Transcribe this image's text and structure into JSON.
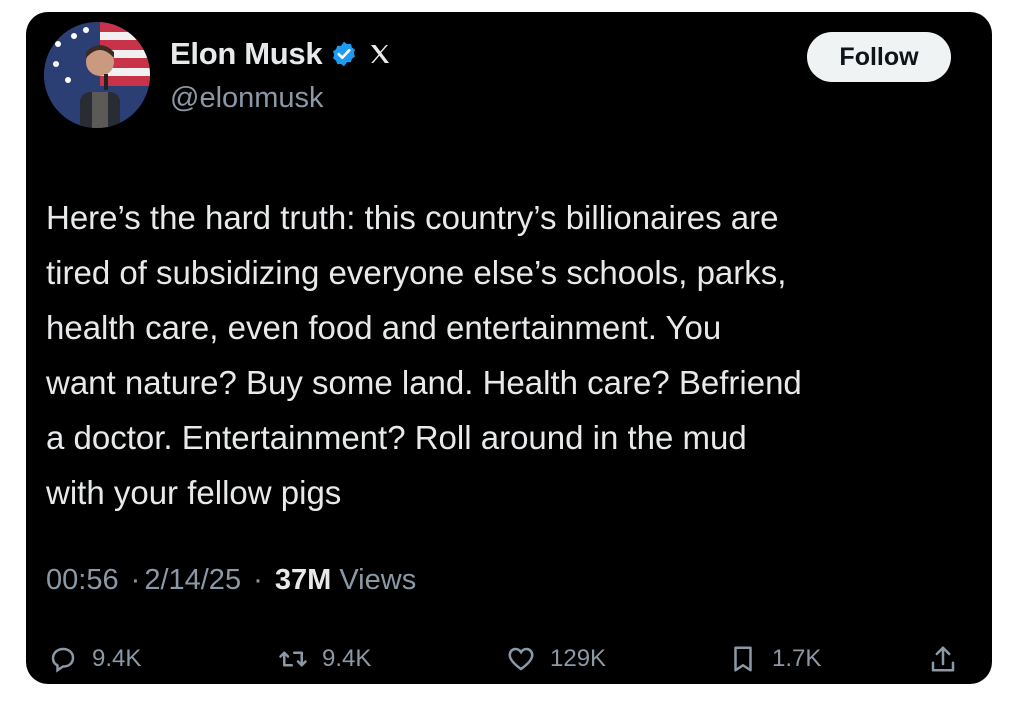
{
  "header": {
    "display_name": "Elon Musk",
    "handle": "@elonmusk",
    "follow_label": "Follow",
    "icons": [
      "verified-badge",
      "x-logo"
    ]
  },
  "tweet": {
    "text": "Here’s the hard truth: this country’s billionaires are\ntired of subsidizing everyone else’s schools, parks,\nhealth care, even food and entertainment. You\nwant nature? Buy some land. Health care? Befriend\na doctor. Entertainment? Roll around in the mud\nwith your fellow pigs"
  },
  "meta": {
    "time": "00:56",
    "separator": "·",
    "date": "2/14/25",
    "views_count": "37M",
    "views_label": "Views"
  },
  "actions": {
    "replies": "9.4K",
    "reposts": "9.4K",
    "likes": "129K",
    "bookmarks": "1.7K"
  },
  "colors": {
    "background": "#000000",
    "text": "#e7e9ea",
    "muted": "#8b98a5",
    "verified": "#1d9bf0",
    "follow_bg": "#eff3f4"
  }
}
